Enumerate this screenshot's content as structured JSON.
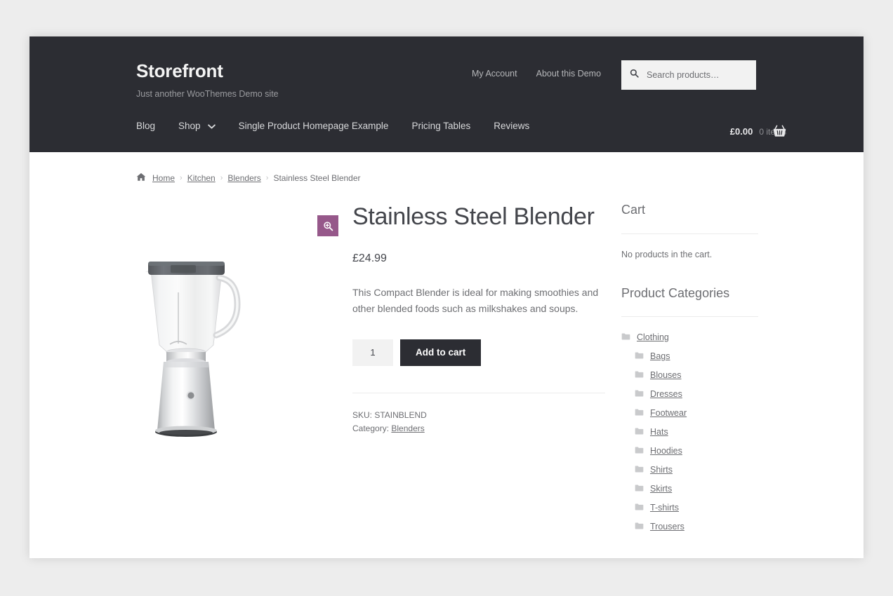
{
  "theme": {
    "header_bg": "#2c2d33",
    "page_bg": "#ededed",
    "accent_purple": "#96588a",
    "button_dark": "#2c2d33",
    "text_muted": "#6d6e72"
  },
  "header": {
    "site_title": "Storefront",
    "site_description": "Just another WooThemes Demo site",
    "secondary_nav": [
      {
        "label": "My Account"
      },
      {
        "label": "About this Demo"
      }
    ],
    "search": {
      "placeholder": "Search products…",
      "value": "",
      "icon": "search-icon"
    },
    "main_nav": [
      {
        "label": "Blog",
        "has_dropdown": false
      },
      {
        "label": "Shop",
        "has_dropdown": true
      },
      {
        "label": "Single Product Homepage Example",
        "has_dropdown": false
      },
      {
        "label": "Pricing Tables",
        "has_dropdown": false
      },
      {
        "label": "Reviews",
        "has_dropdown": false
      }
    ],
    "cart": {
      "amount": "£0.00",
      "count": "0 items",
      "icon": "basket-icon"
    }
  },
  "breadcrumb": {
    "home_icon": "home-icon",
    "items": [
      {
        "label": "Home",
        "link": true
      },
      {
        "label": "Kitchen",
        "link": true
      },
      {
        "label": "Blenders",
        "link": true
      },
      {
        "label": "Stainless Steel Blender",
        "link": false
      }
    ],
    "separator": "›"
  },
  "product": {
    "title": "Stainless Steel Blender",
    "price": "£24.99",
    "description": "This Compact Blender is ideal for making smoothies and other blended foods such as milkshakes and soups.",
    "quantity": "1",
    "add_to_cart_label": "Add to cart",
    "zoom_button_icon": "magnify-plus-icon",
    "image_alt": "stainless-steel-blender-image",
    "sku_line": "SKU: STAINBLEND",
    "category_label": "Category:",
    "category_value": "Blenders"
  },
  "sidebar": {
    "cart_widget": {
      "title": "Cart",
      "empty_text": "No products in the cart."
    },
    "categories_widget": {
      "title": "Product Categories",
      "items": [
        {
          "label": "Clothing",
          "level": 0,
          "icon": "folder-icon"
        },
        {
          "label": "Bags",
          "level": 1,
          "icon": "folder-icon"
        },
        {
          "label": "Blouses",
          "level": 1,
          "icon": "folder-icon"
        },
        {
          "label": "Dresses",
          "level": 1,
          "icon": "folder-icon"
        },
        {
          "label": "Footwear",
          "level": 1,
          "icon": "folder-icon"
        },
        {
          "label": "Hats",
          "level": 1,
          "icon": "folder-icon"
        },
        {
          "label": "Hoodies",
          "level": 1,
          "icon": "folder-icon"
        },
        {
          "label": "Shirts",
          "level": 1,
          "icon": "folder-icon"
        },
        {
          "label": "Skirts",
          "level": 1,
          "icon": "folder-icon"
        },
        {
          "label": "T-shirts",
          "level": 1,
          "icon": "folder-icon"
        },
        {
          "label": "Trousers",
          "level": 1,
          "icon": "folder-icon"
        }
      ]
    }
  }
}
